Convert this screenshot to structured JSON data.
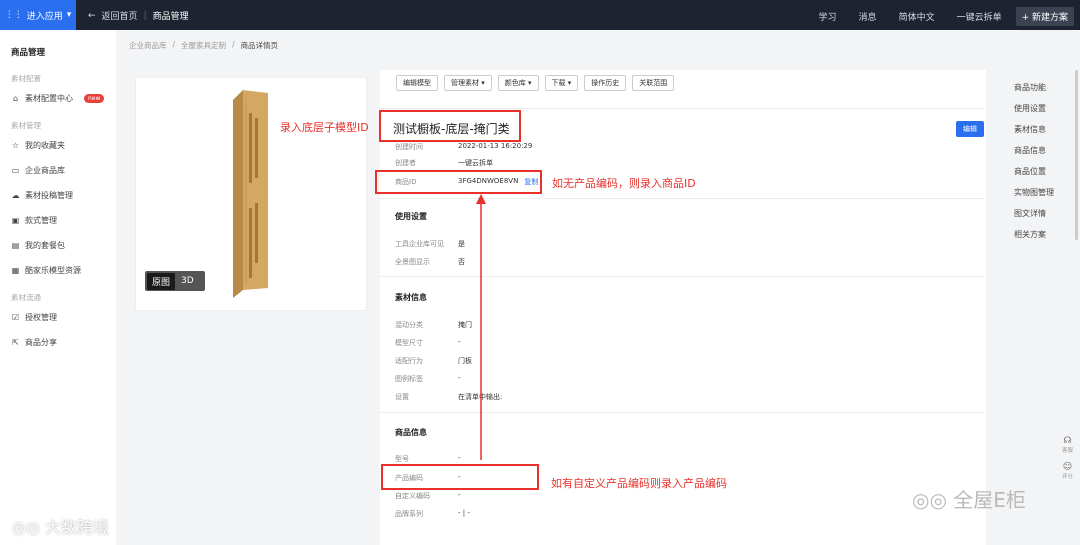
{
  "topbar": {
    "app_label": "进入应用",
    "back_label": "返回首页",
    "current": "商品管理",
    "nav": [
      "学习",
      "消息",
      "简体中文",
      "一键云拆单"
    ],
    "new_label": "+ 新建方案"
  },
  "sidebar": {
    "title": "商品管理",
    "group1": "素材配置",
    "item_config": "素材配置中心",
    "badge": "new",
    "group2": "素材管理",
    "items": [
      "我的收藏夹",
      "企业商品库",
      "素材投稿管理",
      "款式管理",
      "我的套餐包",
      "酷家乐模型资源"
    ],
    "group3": "素材流通",
    "items2": [
      "授权管理",
      "商品分享"
    ]
  },
  "breadcrumb": [
    "企业商品库",
    "全屋家具定制",
    "商品详情页"
  ],
  "preview": {
    "toggle_on": "原图",
    "toggle_off": "3D"
  },
  "toolbar": [
    "编辑模型",
    "管理素材 ▾",
    "颜色库 ▾",
    "下载 ▾",
    "操作历史",
    "关联范围"
  ],
  "detail": {
    "title": "测试橱板-底层-掩门类",
    "edit": "编辑",
    "created_time_label": "创建时间",
    "created_time": "2022-01-13 16:20:29",
    "creator_label": "创建者",
    "creator": "一键云拆单",
    "id_label": "商品ID",
    "id": "3FG4DNWOE8VN",
    "copy": "复制",
    "sec_usage": "使用设置",
    "visible_label": "工具企业库可见",
    "visible": "是",
    "panorama_label": "全景图显示",
    "panorama": "否",
    "sec_material": "素材信息",
    "category_label": "混动分类",
    "category": "掩门",
    "size_label": "模型尺寸",
    "size": "-",
    "behavior_label": "适配行为",
    "behavior": "门板",
    "tag_label": "图例标签",
    "tag": "-",
    "setting_label": "设置",
    "setting": "在清单中输出:",
    "sec_product": "商品信息",
    "model_label": "型号",
    "model": "-",
    "code_label": "产品编码",
    "code": "-",
    "custom_label": "自定义编码",
    "custom": "-",
    "brand_label": "品牌系列",
    "brand": "- | -"
  },
  "rightnav": [
    "商品功能",
    "使用设置",
    "素材信息",
    "商品信息",
    "商品位置",
    "实物图管理",
    "图文详情",
    "相关方案"
  ],
  "float": [
    "客服",
    "评分"
  ],
  "annotations": {
    "a1": "录入底层子模型ID",
    "a2": "如无产品编码，则录入商品ID",
    "a3": "如有自定义产品编码则录入产品编码"
  },
  "watermarks": {
    "left": "大数跨境",
    "right": "全屋E柜"
  },
  "colors": {
    "accent": "#2a6ff0",
    "annotation": "#e8312b",
    "topbar": "#1d2330"
  }
}
